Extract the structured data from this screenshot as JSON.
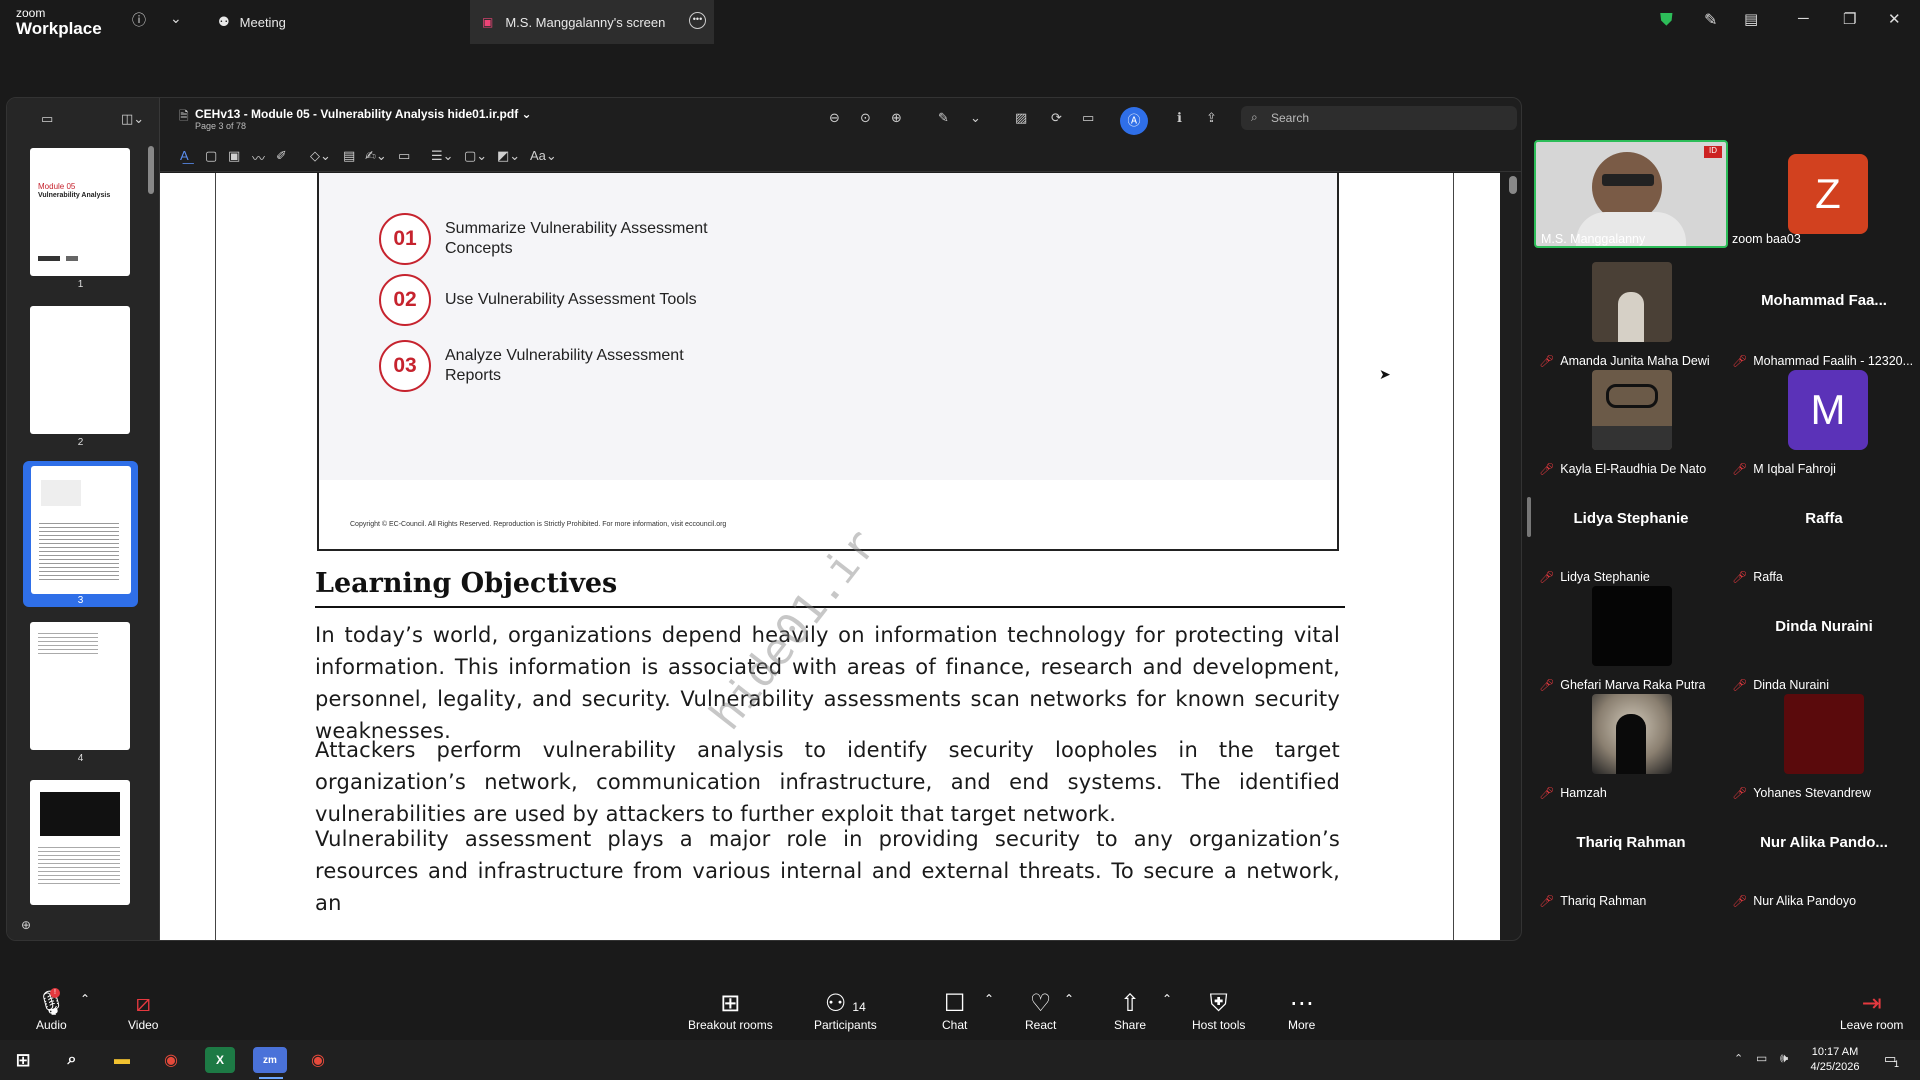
{
  "app": {
    "logo_line1": "zoom",
    "logo_line2": "Workplace"
  },
  "top_tabs": {
    "meeting": "Meeting",
    "screen": "M.S. Manggalanny's screen"
  },
  "viewer": {
    "doc_title": "CEHv13 - Module 05 - Vulnerability Analysis hide01.ir.pdf",
    "doc_subtitle": "Page 3 of 78",
    "search_placeholder": "Search",
    "thumbnails": [
      {
        "num": "1",
        "line1": "Module 05",
        "line2": "Vulnerability Analysis"
      },
      {
        "num": "2"
      },
      {
        "num": "3"
      },
      {
        "num": "4"
      },
      {
        "num": ""
      }
    ],
    "selected_thumbnail": "3"
  },
  "document": {
    "objectives": [
      {
        "num": "01",
        "text": "Summarize Vulnerability Assessment Concepts"
      },
      {
        "num": "02",
        "text": "Use Vulnerability Assessment Tools"
      },
      {
        "num": "03",
        "text": "Analyze Vulnerability Assessment Reports"
      }
    ],
    "copyright": "Copyright © EC-Council. All Rights Reserved. Reproduction is Strictly Prohibited. For more information, visit eccouncil.org",
    "section_title": "Learning Objectives",
    "paragraphs": [
      "In today’s world, organizations depend heavily on information technology for protecting vital information. This information is associated with areas of finance, research and development, personnel, legality, and security. Vulnerability assessments scan networks for known security weaknesses.",
      "Attackers perform vulnerability analysis to identify security loopholes in the target organization’s network, communication infrastructure, and end systems. The identified vulnerabilities are used by attackers to further exploit that target network.",
      "Vulnerability assessment plays a major role in providing security to any organization’s resources and infrastructure from various internal and external threats. To secure a network, an"
    ],
    "watermark": "hide01.ir"
  },
  "participants": [
    {
      "name": "M.S. Manggalanny",
      "type": "video",
      "color": "#c9c9c9"
    },
    {
      "name": "zoom baa03",
      "type": "avatar",
      "letter": "Z",
      "color": "#d2411f"
    },
    {
      "name": "Amanda Junita Maha Dewi",
      "type": "video",
      "color": "#4a4036"
    },
    {
      "name": "Mohammad Faalih - 12320...",
      "type": "name",
      "display": "Mohammad Faa..."
    },
    {
      "name": "Kayla El-Raudhia De Nato",
      "type": "video",
      "color": "#6b5a48"
    },
    {
      "name": "M Iqbal Fahroji",
      "type": "avatar",
      "letter": "M",
      "color": "#5b32b8"
    },
    {
      "name": "Lidya Stephanie",
      "type": "name",
      "display": "Lidya Stephanie"
    },
    {
      "name": "Raffa",
      "type": "name",
      "display": "Raffa"
    },
    {
      "name": "Ghefari Marva Raka Putra",
      "type": "video",
      "color": "#050505"
    },
    {
      "name": "Dinda Nuraini",
      "type": "name",
      "display": "Dinda Nuraini"
    },
    {
      "name": "Hamzah",
      "type": "video",
      "color": "#3b3b3b"
    },
    {
      "name": "Yohanes Stevandrew",
      "type": "video",
      "color": "#5a0a0c"
    },
    {
      "name": "Thariq Rahman",
      "type": "name",
      "display": "Thariq Rahman"
    },
    {
      "name": "Nur Alika Pandoyo",
      "type": "name",
      "display": "Nur Alika Pando..."
    }
  ],
  "bottom_bar": {
    "audio": "Audio",
    "video": "Video",
    "breakout": "Breakout rooms",
    "participants": "Participants",
    "participants_count": "14",
    "chat": "Chat",
    "react": "React",
    "share": "Share",
    "host_tools": "Host tools",
    "more": "More",
    "leave": "Leave room"
  },
  "taskbar": {
    "time": "10:17 AM",
    "date": "4/25/2026",
    "notification_count": "1"
  },
  "colors": {
    "accent_blue": "#2f6fe8",
    "objective_red": "#c6232e",
    "mute_red": "#e5393f",
    "shield_green": "#2dbd59"
  }
}
